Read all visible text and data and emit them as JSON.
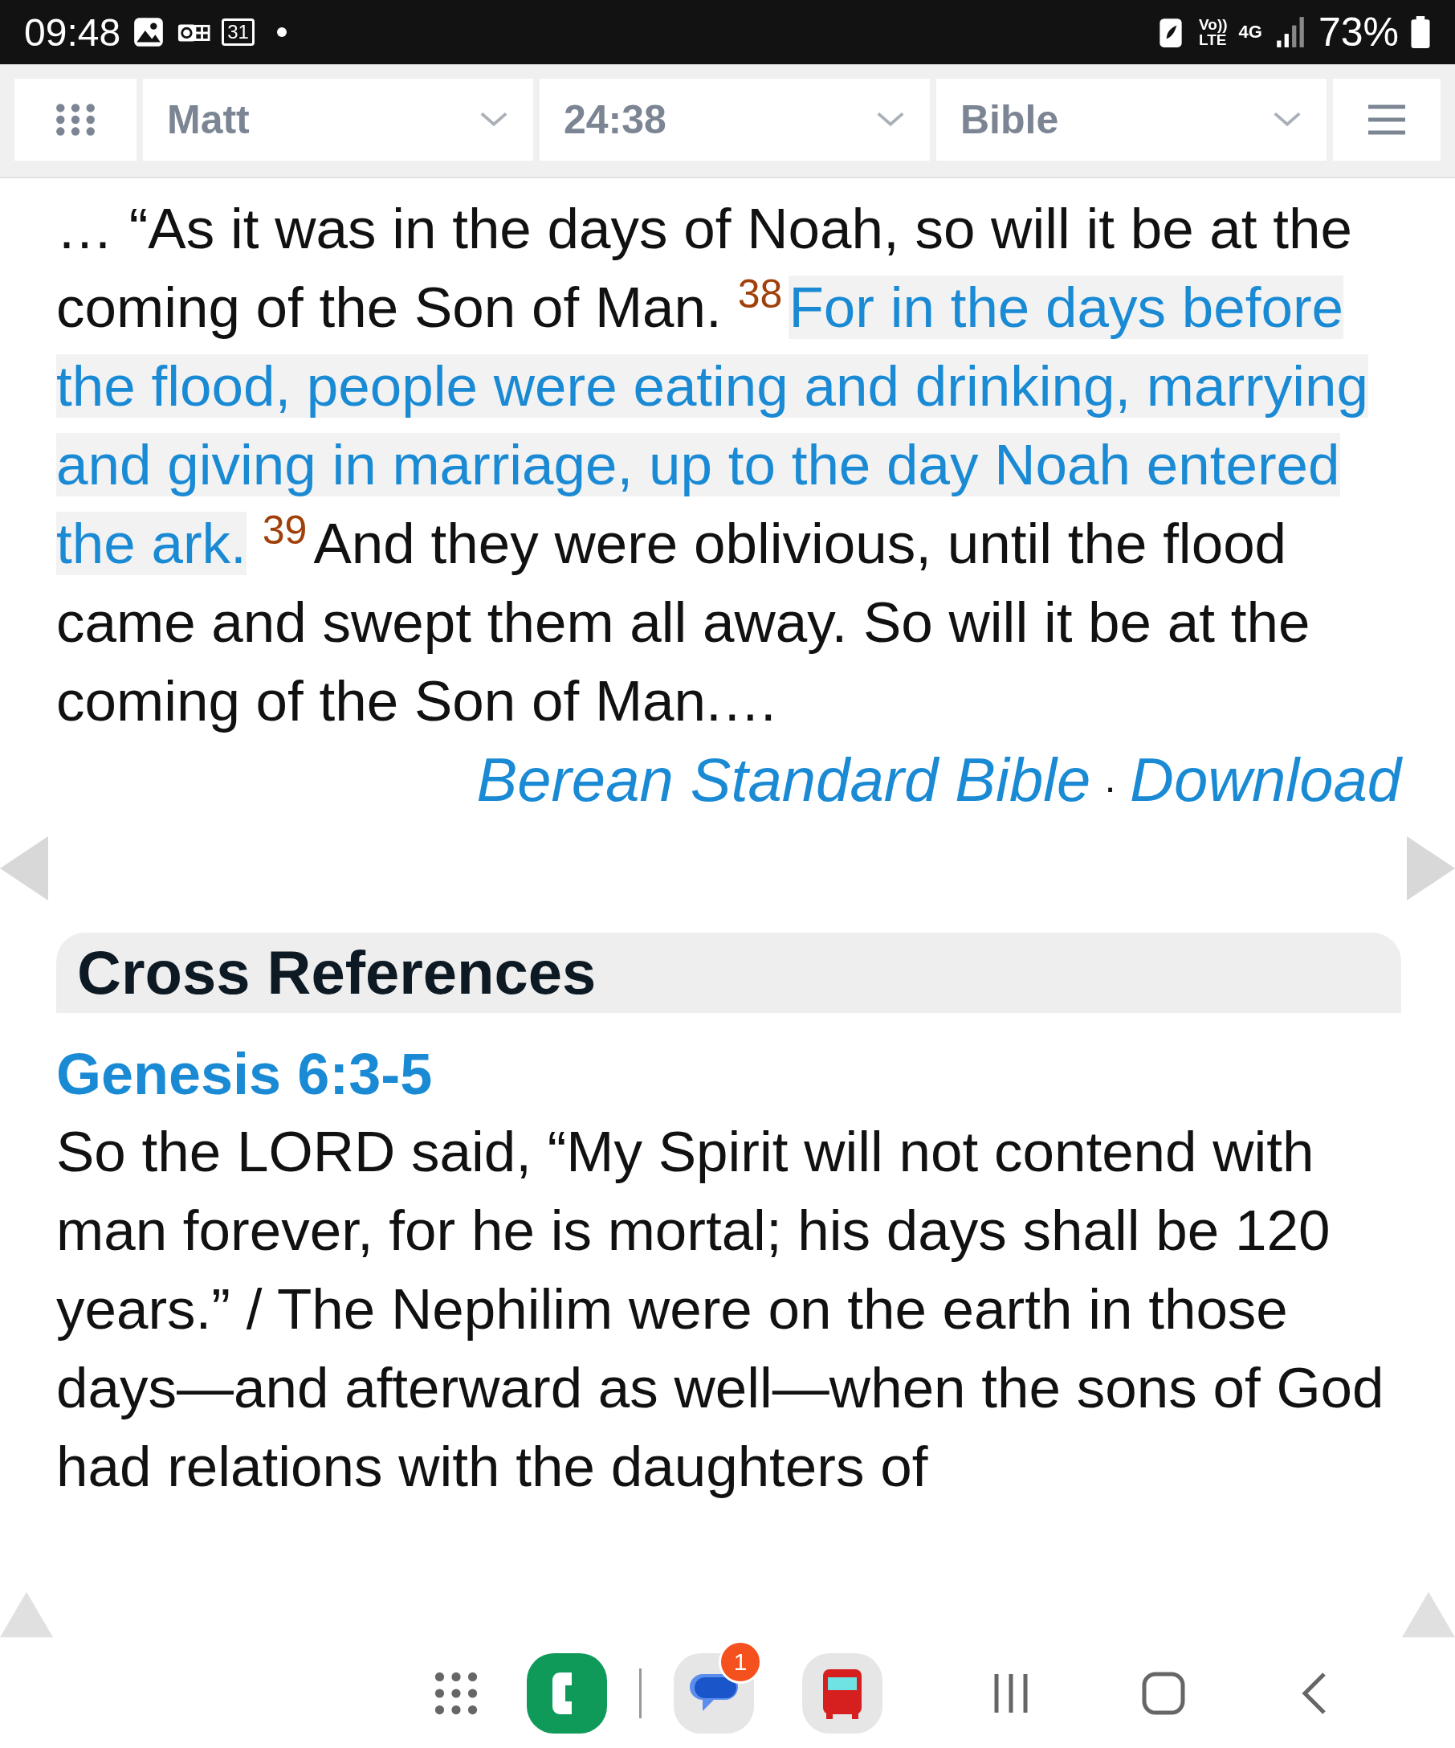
{
  "status_bar": {
    "time": "09:48",
    "calendar_day": "31",
    "volte": "Vo))",
    "volte_sub": "LTE",
    "network": "4G",
    "battery": "73%"
  },
  "toolbar": {
    "book": "Matt",
    "reference": "24:38",
    "version": "Bible"
  },
  "passage": {
    "segments": [
      {
        "kind": "text",
        "highlighted": false,
        "text": "… “As it was in the days of Noah, so will it be at the coming of the Son of Man."
      },
      {
        "kind": "verse",
        "text": "38"
      },
      {
        "kind": "text",
        "highlighted": true,
        "text": "For in the days before the flood, people were eating and drinking, marrying and giving in marriage, up to the day Noah entered the ark."
      },
      {
        "kind": "verse",
        "text": "39"
      },
      {
        "kind": "text",
        "highlighted": false,
        "text": "And they were oblivious, until the flood came and swept them all away. So will it be at the coming of the Son of Man.…"
      }
    ],
    "source": "Berean Standard Bible",
    "separator": "·",
    "download": "Download"
  },
  "cross_references": {
    "heading": "Cross References",
    "items": [
      {
        "reference": "Genesis 6:3-5",
        "text": "So the LORD said, “My Spirit will not contend with man forever, for he is mortal; his days shall be 120 years.” / The Nephilim were on the earth in those days—and afterward as well—when the sons of God had relations with the daughters of"
      }
    ]
  },
  "nav_bar": {
    "apps": [
      {
        "kind": "grid"
      },
      {
        "kind": "phone"
      },
      {
        "kind": "messages",
        "badge": "1"
      },
      {
        "kind": "bus"
      }
    ]
  }
}
